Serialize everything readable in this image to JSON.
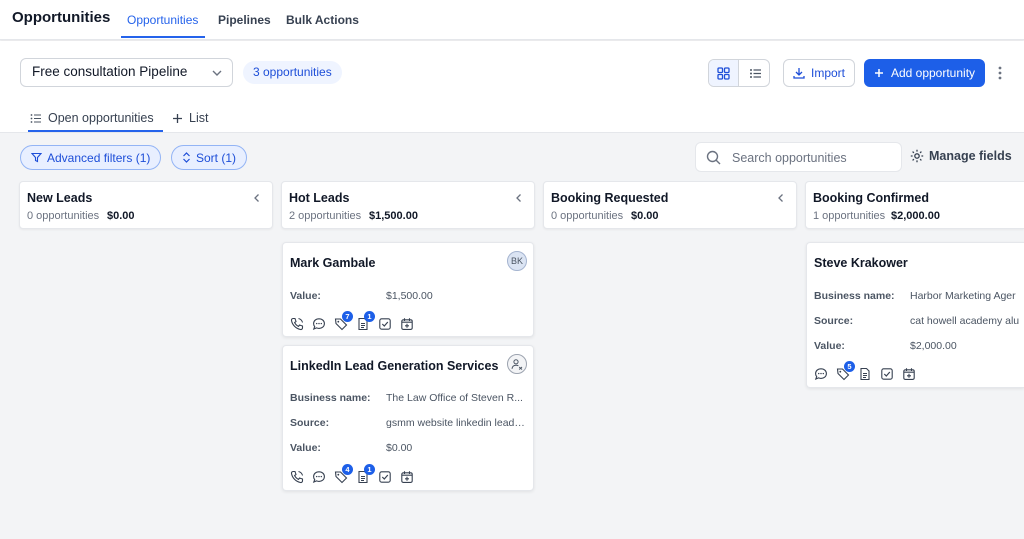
{
  "app": {
    "title": "Opportunities"
  },
  "nav_tabs": [
    {
      "label": "Opportunities",
      "active": true
    },
    {
      "label": "Pipelines",
      "active": false
    },
    {
      "label": "Bulk Actions",
      "active": false
    }
  ],
  "toolbar": {
    "pipeline_selected": "Free consultation Pipeline",
    "count_label": "3 opportunities",
    "view_mode": "grid",
    "import_label": "Import",
    "add_label": "Add opportunity"
  },
  "subtabs": [
    {
      "label": "Open opportunities",
      "icon": "list-icon",
      "active": true
    },
    {
      "label": "List",
      "icon": "plus-icon",
      "active": false
    }
  ],
  "filters": {
    "advanced_label": "Advanced filters (1)",
    "sort_label": "Sort (1)",
    "search_placeholder": "Search opportunities",
    "manage_fields_label": "Manage fields"
  },
  "columns": [
    {
      "name": "New Leads",
      "count": "0 opportunities",
      "value": "$0.00"
    },
    {
      "name": "Hot Leads",
      "count": "2 opportunities",
      "value": "$1,500.00"
    },
    {
      "name": "Booking Requested",
      "count": "0 opportunities",
      "value": "$0.00"
    },
    {
      "name": "Booking Confirmed",
      "count": "1 opportunities",
      "value": "$2,000.00"
    }
  ],
  "cards": [
    {
      "title": "Mark Gambale",
      "avatar": "BK",
      "fields": [
        {
          "label": "Value:",
          "value": "$1,500.00"
        }
      ],
      "tags_badge": "7",
      "notes_badge": "1"
    },
    {
      "title": "LinkedIn Lead Generation Services",
      "avatar_icon": "assign-user-icon",
      "fields": [
        {
          "label": "Business name:",
          "value": "The Law Office of Steven R..."
        },
        {
          "label": "Source:",
          "value": "gsmm website linkedin lead ..."
        },
        {
          "label": "Value:",
          "value": "$0.00"
        }
      ],
      "tags_badge": "4",
      "notes_badge": "1"
    },
    {
      "title": "Steve Krakower",
      "fields": [
        {
          "label": "Business name:",
          "value": "Harbor Marketing Ager"
        },
        {
          "label": "Source:",
          "value": "cat howell academy alu"
        },
        {
          "label": "Value:",
          "value": "$2,000.00"
        }
      ],
      "tags_badge": "5"
    }
  ],
  "colors": {
    "accent": "#2563eb",
    "primary_button": "#1d5fe8",
    "pill_bg": "#e8efff"
  }
}
